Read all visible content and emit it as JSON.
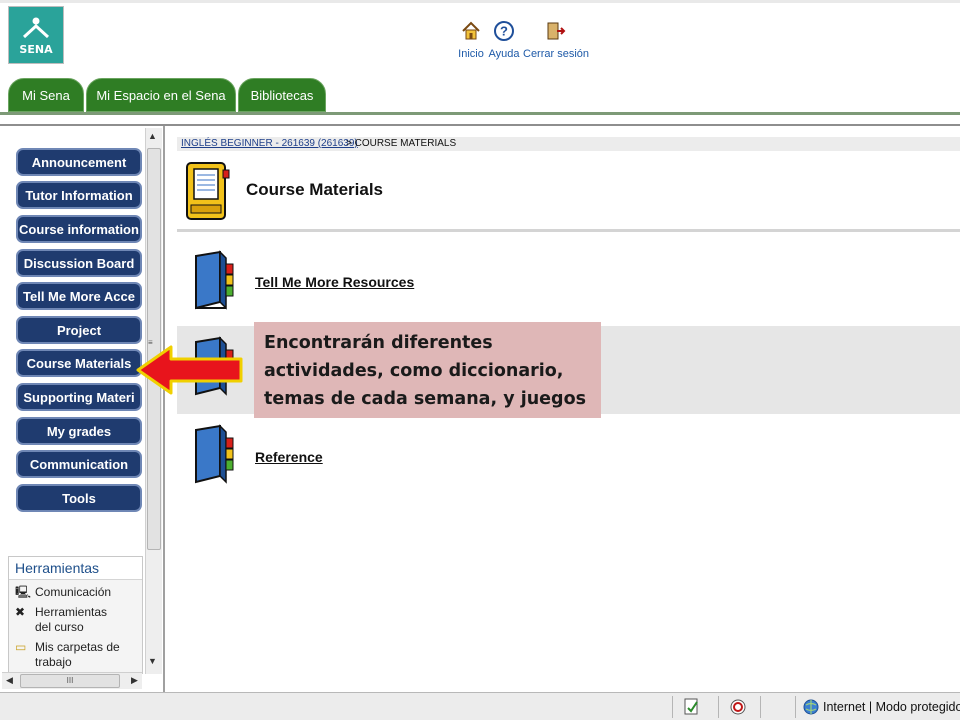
{
  "header": {
    "logo_text": "SENA",
    "links": [
      {
        "label": "Inicio",
        "icon": "home-icon"
      },
      {
        "label": "Ayuda",
        "icon": "help-icon"
      },
      {
        "label": "Cerrar sesión",
        "icon": "logout-door-icon"
      }
    ],
    "tabs": [
      "Mi Sena",
      "Mi Espacio en el Sena",
      "Bibliotecas"
    ]
  },
  "sidebar": {
    "menu": [
      "Announcement",
      "Tutor Information",
      "Course information",
      "Discussion Board",
      "Tell Me More Acce",
      "Project",
      "Course Materials",
      "Supporting Materi",
      "My grades",
      "Communication",
      "Tools"
    ],
    "tools_panel": {
      "title": "Herramientas",
      "items": [
        {
          "label": "Comunicación",
          "icon": "computer-icon"
        },
        {
          "label": "Herramientas del curso",
          "icon": "tools-icon"
        },
        {
          "label": "Mis carpetas de trabajo",
          "icon": "folder-icon"
        }
      ]
    },
    "scroll_thumb_label": "III"
  },
  "content": {
    "breadcrumb_link": "INGLÉS BEGINNER - 261639 (261639)",
    "breadcrumb_current": "> COURSE MATERIALS",
    "title": "Course Materials",
    "items": [
      {
        "label": "Tell Me More Resources",
        "icon": "book-icon"
      },
      {
        "label": "",
        "icon": "book-icon"
      },
      {
        "label": "Reference",
        "icon": "book-icon"
      }
    ]
  },
  "callout": {
    "lines": [
      "Encontrarán diferentes",
      "actividades, como diccionario,",
      "temas de cada semana, y juegos"
    ]
  },
  "statusbar": {
    "zone": "Internet | Modo protegido"
  },
  "colors": {
    "tab_green": "#2f7d24",
    "menu_navy": "#1f3b6f",
    "callout_pink": "#dfb7b7",
    "arrow_red": "#e8141c",
    "arrow_outline": "#f0d000"
  }
}
